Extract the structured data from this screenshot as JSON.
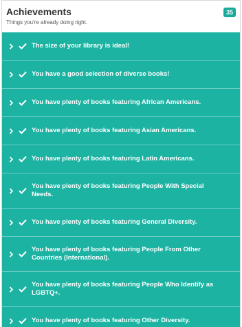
{
  "header": {
    "title": "Achievements",
    "subtitle": "Things you're already doing right.",
    "badge_count": "35"
  },
  "colors": {
    "accent": "#1db3a3",
    "badge": "#1aaa9a",
    "text_on_accent": "#ffffff"
  },
  "items": [
    {
      "label": "The size of your library is ideal!"
    },
    {
      "label": "You have a good selection of diverse books!"
    },
    {
      "label": "You have plenty of books featuring African Americans."
    },
    {
      "label": "You have plenty of books featuring Asian Americans."
    },
    {
      "label": "You have plenty of books featuring Latin Americans."
    },
    {
      "label": "You have plenty of books featuring People With Special Needs."
    },
    {
      "label": "You have plenty of books featuring General Diversity."
    },
    {
      "label": "You have plenty of books featuring People From Other Countries (International)."
    },
    {
      "label": "You have plenty of books featuring People Who Identify as LGBTQ+."
    },
    {
      "label": "You have plenty of books featuring Other Diversity."
    }
  ]
}
